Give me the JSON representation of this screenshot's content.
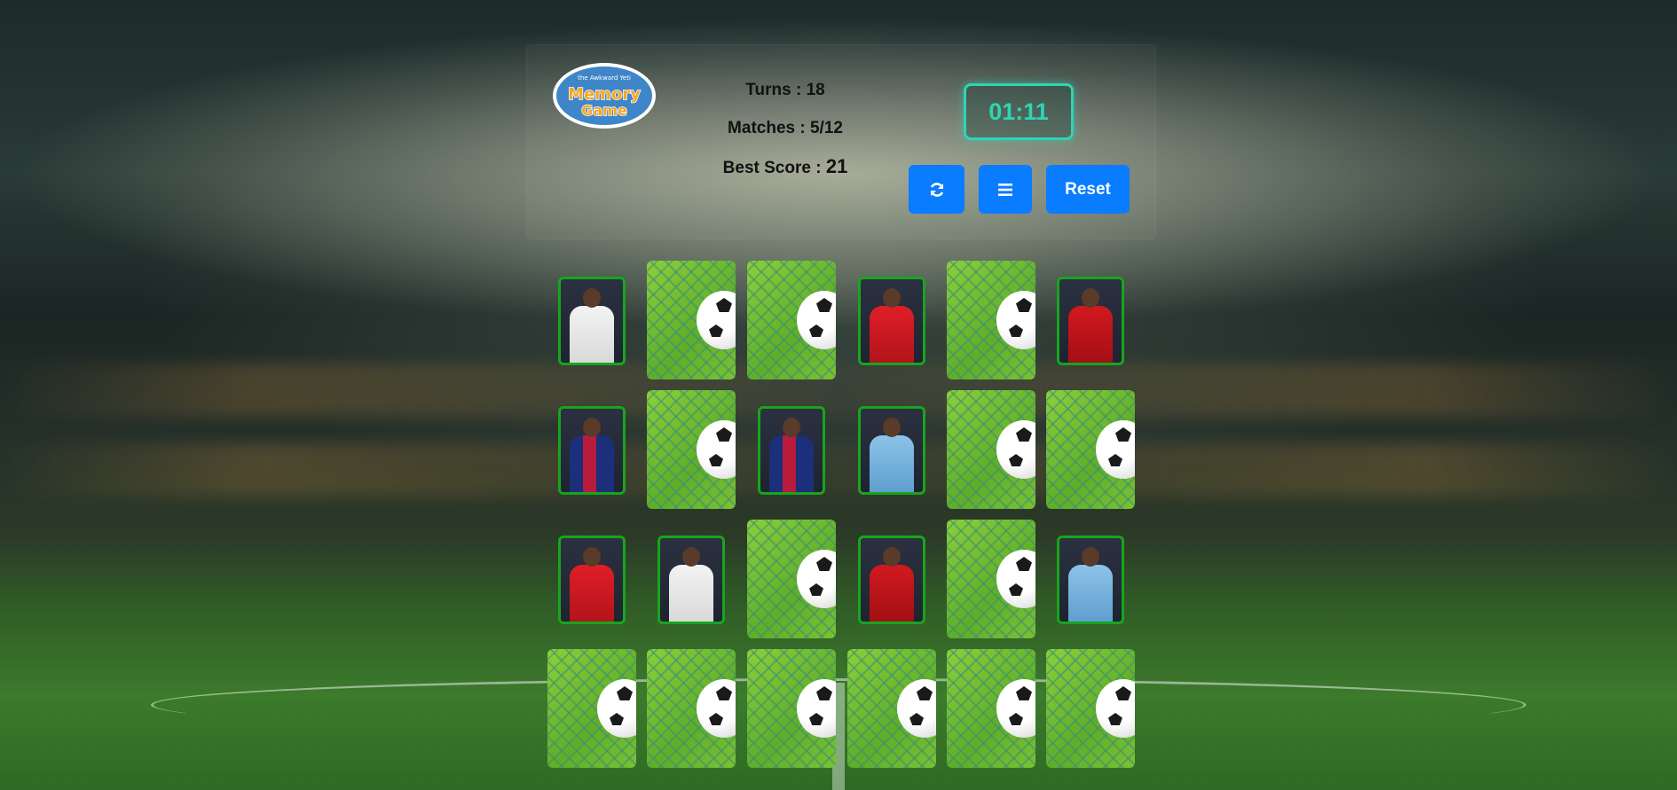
{
  "game": {
    "logo_top": "the Awkward Yeti",
    "logo_main": "Memory Game",
    "turns_label": "Turns : ",
    "turns": "18",
    "matches_label": "Matches : ",
    "matches": "5/12",
    "best_label": "Best Score : ",
    "best": "21",
    "timer": "01:11",
    "reset_label": "Reset"
  },
  "icons": {
    "refresh": "refresh-icon",
    "menu": "menu-icon"
  },
  "colors": {
    "button": "#0a7cff",
    "timer": "#2fd4b4",
    "matched_border": "#17a51e"
  },
  "board": {
    "rows": 4,
    "cols": 6,
    "cards": [
      "player-white",
      "back",
      "back",
      "player-red",
      "back",
      "player-liv",
      "player-barca",
      "back",
      "player-barca",
      "player-city",
      "back",
      "back",
      "player-red",
      "player-white",
      "back",
      "player-liv",
      "back",
      "player-city",
      "back",
      "back",
      "back",
      "back",
      "back",
      "back"
    ]
  }
}
